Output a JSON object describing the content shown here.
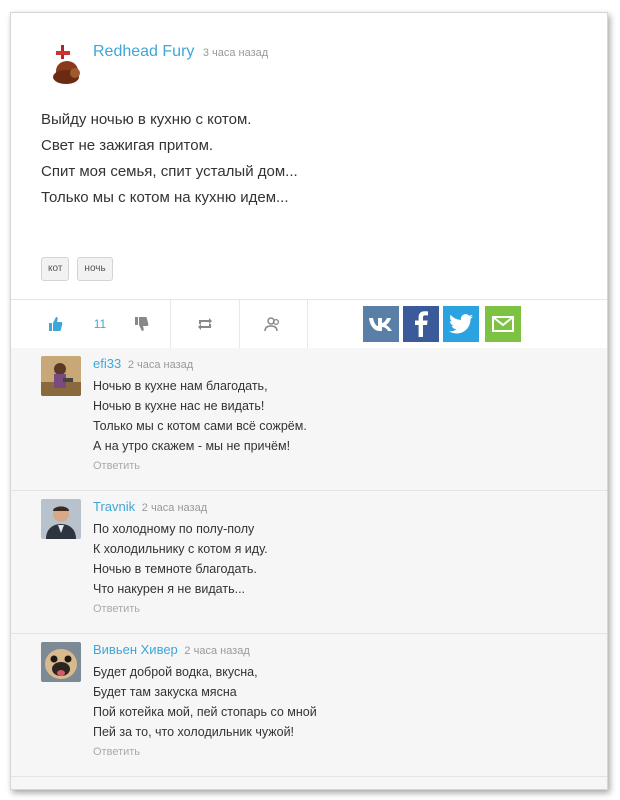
{
  "post": {
    "author": "Redhead Fury",
    "time": "3 часа назад",
    "lines": [
      "Выйду ночью в кухню с котом.",
      "Свет не зажигая притом.",
      "Спит моя семья, спит усталый дом...",
      "Только мы с котом на кухню идем..."
    ],
    "tags": [
      "кот",
      "ночь"
    ]
  },
  "actions": {
    "like_count": "11",
    "icons": [
      "thumbs-up-icon",
      "thumbs-down-icon",
      "repost-icon",
      "users-icon"
    ],
    "social": [
      {
        "name": "vk",
        "color": "#5a7fa6"
      },
      {
        "name": "facebook",
        "color": "#3b5a9a"
      },
      {
        "name": "twitter",
        "color": "#2aa3e0"
      },
      {
        "name": "email",
        "color": "#7dc242"
      }
    ]
  },
  "comments": [
    {
      "author": "efi33",
      "time": "2 часа назад",
      "lines": [
        "Ночью в кухне нам благодать,",
        "Ночью в кухне нас не видать!",
        "Только мы с котом сами всё сожрём.",
        "А на утро скажем - мы не причём!"
      ],
      "reply": "Ответить"
    },
    {
      "author": "Travnik",
      "time": "2 часа назад",
      "lines": [
        "По холодному по полу-полу",
        "К холодильнику с котом я иду.",
        "Ночью в темноте благодать.",
        "Что накурен я не видать..."
      ],
      "reply": "Ответить"
    },
    {
      "author": "Вивьен Хивер",
      "time": "2 часа назад",
      "lines": [
        "Будет доброй водка, вкусна,",
        "Будет там закуска мясна",
        "Пой котейка мой, пей стопарь со мной",
        "Пей за то, что холодильник чужой!"
      ],
      "reply": "Ответить"
    }
  ],
  "colors": {
    "accent": "#3ea6d8",
    "comments_bg": "#f6f6f6"
  }
}
